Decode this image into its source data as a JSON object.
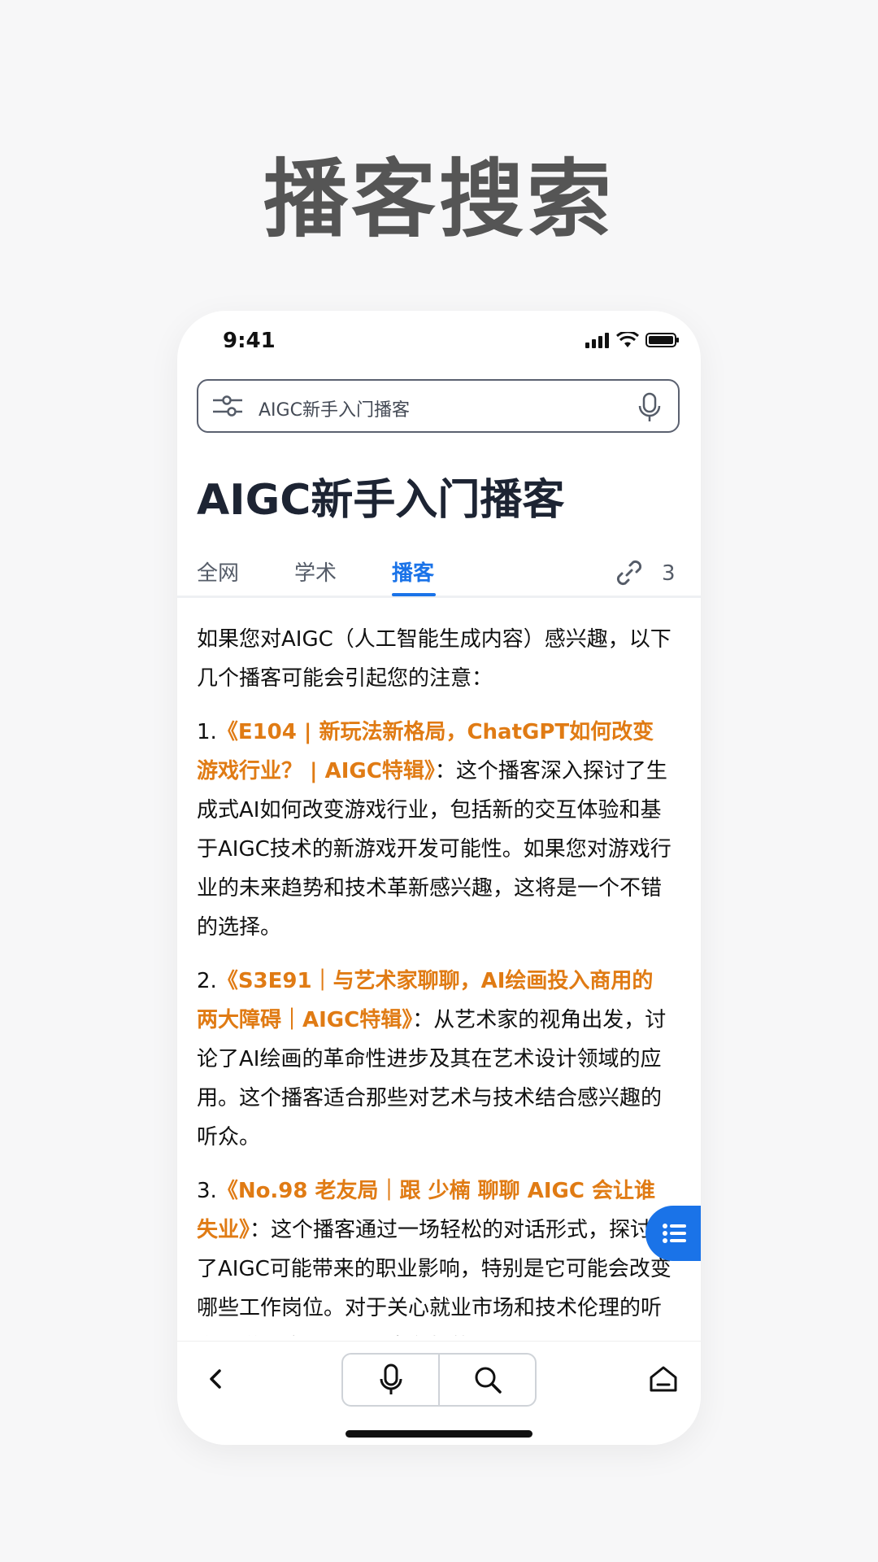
{
  "hero": {
    "title": "播客搜索"
  },
  "status": {
    "time": "9:41"
  },
  "search": {
    "query": "AIGC新手入门播客"
  },
  "page": {
    "title": "AIGC新手入门播客"
  },
  "tabs": [
    {
      "label": "全网"
    },
    {
      "label": "学术"
    },
    {
      "label": "播客",
      "active": true
    }
  ],
  "links": {
    "count": "3"
  },
  "answer": {
    "intro": "如果您对AIGC（人工智能生成内容）感兴趣，以下几个播客可能会引起您的注意：",
    "items": [
      {
        "num": "1.",
        "title": "《E104 | 新玩法新格局，ChatGPT如何改变游戏行业？ | AIGC特辑》",
        "desc": "：这个播客深入探讨了生成式AI如何改变游戏行业，包括新的交互体验和基于AIGC技术的新游戏开发可能性。如果您对游戏行业的未来趋势和技术革新感兴趣，这将是一个不错的选择。"
      },
      {
        "num": "2.",
        "title": "《S3E91｜与艺术家聊聊，AI绘画投入商用的两大障碍｜AIGC特辑》",
        "desc": "：从艺术家的视角出发，讨论了AI绘画的革命性进步及其在艺术设计领域的应用。这个播客适合那些对艺术与技术结合感兴趣的听众。"
      },
      {
        "num": "3.",
        "title": "《No.98 老友局｜跟 少楠 聊聊 AIGC 会让谁失业》",
        "desc": "：这个播客通过一场轻松的对话形式，探讨了AIGC可能带来的职业影响，特别是它可能会改变哪些工作岗位。对于关心就业市场和技术伦理的听众来说，这是一个非常有趣的节目。"
      }
    ]
  },
  "colors": {
    "accent": "#1a73e8",
    "highlight": "#e07b14"
  }
}
